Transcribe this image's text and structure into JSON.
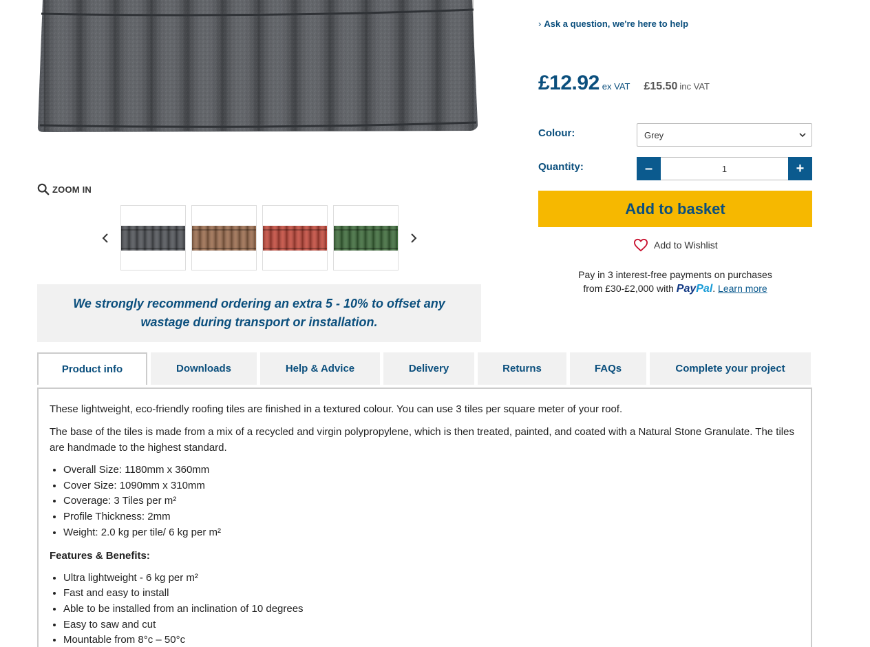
{
  "ask_link": "Ask a question, we're here to help",
  "price": {
    "ex_vat": "£12.92",
    "ex_vat_label": "ex VAT",
    "inc_vat": "£15.50",
    "inc_vat_label": "inc VAT"
  },
  "colour": {
    "label": "Colour:",
    "selected": "Grey"
  },
  "quantity": {
    "label": "Quantity:",
    "value": "1",
    "minus": "–",
    "plus": "+"
  },
  "basket_label": "Add to basket",
  "wishlist_label": "Add to Wishlist",
  "paypal": {
    "line1": "Pay in 3 interest-free payments on purchases",
    "line2_prefix": "from £30-£2,000 with",
    "logo_pay": "Pay",
    "logo_pal": "Pal",
    "line2_suffix": ".",
    "learn_more": "Learn more"
  },
  "zoom_label": "ZOOM IN",
  "thumbnails": [
    {
      "name": "grey",
      "color": "#4f5257"
    },
    {
      "name": "brown",
      "color": "#9a6b4c"
    },
    {
      "name": "red",
      "color": "#c2483a"
    },
    {
      "name": "green",
      "color": "#3d6b3a"
    }
  ],
  "recommend_text": "We strongly recommend ordering an extra 5 - 10% to offset any wastage during transport or installation.",
  "tabs": [
    {
      "label": "Product info",
      "active": true
    },
    {
      "label": "Downloads"
    },
    {
      "label": "Help & Advice"
    },
    {
      "label": "Delivery"
    },
    {
      "label": "Returns"
    },
    {
      "label": "FAQs"
    },
    {
      "label": "Complete your project"
    }
  ],
  "product_info": {
    "intro": "These lightweight, eco-friendly roofing tiles are finished in a textured colour. You can use 3 tiles per square meter of your roof.",
    "base": "The base of the tiles is made from a mix of a recycled and virgin polypropylene, which is then treated, painted, and coated with a Natural Stone Granulate. The tiles are handmade to the highest standard.",
    "specs": [
      "Overall Size: 1180mm x 360mm",
      "Cover Size: 1090mm x 310mm",
      "Coverage: 3 Tiles per m²",
      "Profile Thickness: 2mm",
      "Weight: 2.0 kg per tile/ 6 kg per m²"
    ],
    "features_title": "Features & Benefits:",
    "features": [
      "Ultra lightweight - 6 kg per m²",
      "Fast and easy to install",
      "Able to be installed from an inclination of 10 degrees",
      "Easy to saw and cut",
      "Mountable from 8°c – 50°c"
    ]
  },
  "colors": {
    "brand_blue": "#0b4f7d",
    "button_blue": "#0b5a8e",
    "basket_yellow": "#f6b800",
    "panel_grey": "#f1f1f1"
  }
}
